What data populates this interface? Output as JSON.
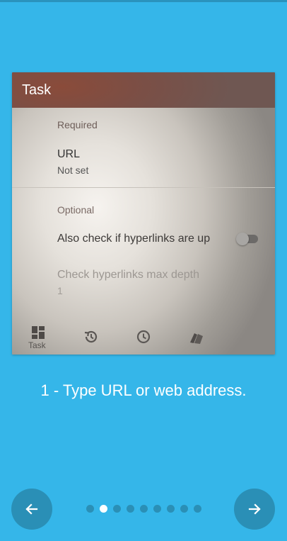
{
  "screenshot": {
    "header_title": "Task",
    "section_required": "Required",
    "url_label": "URL",
    "url_value": "Not set",
    "section_optional": "Optional",
    "hyperlinks_label": "Also check if hyperlinks are up",
    "hyperlinks_enabled": false,
    "depth_label": "Check hyperlinks max depth",
    "depth_value": "1",
    "bottom_nav": [
      {
        "icon": "dashboard-icon",
        "label": "Task"
      },
      {
        "icon": "history-icon",
        "label": ""
      },
      {
        "icon": "clock-icon",
        "label": ""
      },
      {
        "icon": "cards-icon",
        "label": ""
      }
    ]
  },
  "caption": "1 - Type URL or web address.",
  "navigation": {
    "prev_icon": "arrow-left-icon",
    "next_icon": "arrow-right-icon",
    "page_count": 9,
    "current_page": 2
  },
  "colors": {
    "background": "#35b6e9",
    "button": "#2a8fb6",
    "dot_inactive": "#2a8fb6",
    "dot_active": "#ffffff"
  }
}
